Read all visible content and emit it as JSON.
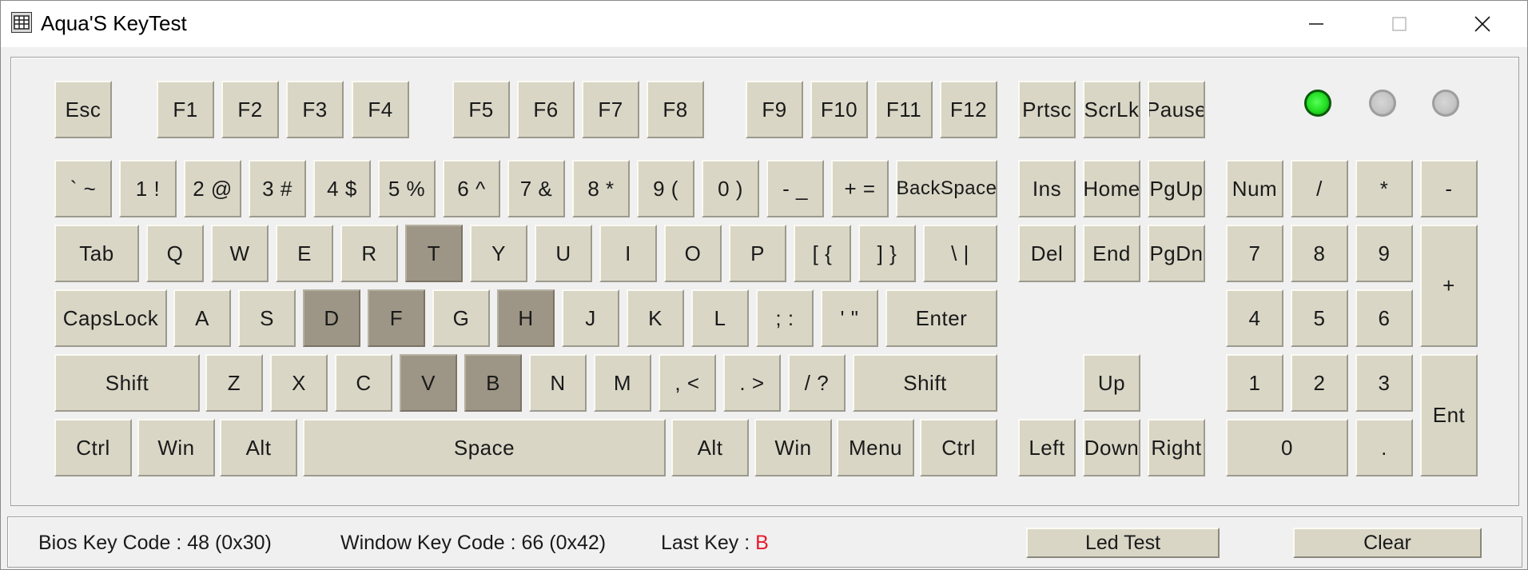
{
  "window": {
    "title": "Aqua'S KeyTest",
    "icon": "keyboard-grid-icon"
  },
  "controls": {
    "minimize": "minimize-icon",
    "maximize": "maximize-icon",
    "close": "close-icon"
  },
  "keys": [
    {
      "id": "esc",
      "label": "Esc",
      "pressed": false
    },
    {
      "id": "f1",
      "label": "F1",
      "pressed": false
    },
    {
      "id": "f2",
      "label": "F2",
      "pressed": false
    },
    {
      "id": "f3",
      "label": "F3",
      "pressed": false
    },
    {
      "id": "f4",
      "label": "F4",
      "pressed": false
    },
    {
      "id": "f5",
      "label": "F5",
      "pressed": false
    },
    {
      "id": "f6",
      "label": "F6",
      "pressed": false
    },
    {
      "id": "f7",
      "label": "F7",
      "pressed": false
    },
    {
      "id": "f8",
      "label": "F8",
      "pressed": false
    },
    {
      "id": "f9",
      "label": "F9",
      "pressed": false
    },
    {
      "id": "f10",
      "label": "F10",
      "pressed": false
    },
    {
      "id": "f11",
      "label": "F11",
      "pressed": false
    },
    {
      "id": "f12",
      "label": "F12",
      "pressed": false
    },
    {
      "id": "prtsc",
      "label": "Prtsc",
      "pressed": false
    },
    {
      "id": "scrlk",
      "label": "ScrLk",
      "pressed": false
    },
    {
      "id": "pause",
      "label": "Pause",
      "pressed": false
    },
    {
      "id": "backtick",
      "label": "` ~",
      "pressed": false
    },
    {
      "id": "1",
      "label": "1 !",
      "pressed": false
    },
    {
      "id": "2",
      "label": "2 @",
      "pressed": false
    },
    {
      "id": "3",
      "label": "3 #",
      "pressed": false
    },
    {
      "id": "4",
      "label": "4 $",
      "pressed": false
    },
    {
      "id": "5",
      "label": "5 %",
      "pressed": false
    },
    {
      "id": "6",
      "label": "6 ^",
      "pressed": false
    },
    {
      "id": "7",
      "label": "7 &",
      "pressed": false
    },
    {
      "id": "8",
      "label": "8 *",
      "pressed": false
    },
    {
      "id": "9",
      "label": "9 (",
      "pressed": false
    },
    {
      "id": "0",
      "label": "0 )",
      "pressed": false
    },
    {
      "id": "minus",
      "label": "- _",
      "pressed": false
    },
    {
      "id": "equals",
      "label": "+ =",
      "pressed": false
    },
    {
      "id": "backspace",
      "label": "BackSpace",
      "pressed": false
    },
    {
      "id": "ins",
      "label": "Ins",
      "pressed": false
    },
    {
      "id": "home",
      "label": "Home",
      "pressed": false
    },
    {
      "id": "pgup",
      "label": "PgUp",
      "pressed": false
    },
    {
      "id": "numlock",
      "label": "Num",
      "pressed": false
    },
    {
      "id": "numslash",
      "label": "/",
      "pressed": false
    },
    {
      "id": "numstar",
      "label": "*",
      "pressed": false
    },
    {
      "id": "numminus",
      "label": "-",
      "pressed": false
    },
    {
      "id": "tab",
      "label": "Tab",
      "pressed": false
    },
    {
      "id": "q",
      "label": "Q",
      "pressed": false
    },
    {
      "id": "w",
      "label": "W",
      "pressed": false
    },
    {
      "id": "e",
      "label": "E",
      "pressed": false
    },
    {
      "id": "r",
      "label": "R",
      "pressed": false
    },
    {
      "id": "t",
      "label": "T",
      "pressed": true
    },
    {
      "id": "y",
      "label": "Y",
      "pressed": false
    },
    {
      "id": "u",
      "label": "U",
      "pressed": false
    },
    {
      "id": "i",
      "label": "I",
      "pressed": false
    },
    {
      "id": "o",
      "label": "O",
      "pressed": false
    },
    {
      "id": "p",
      "label": "P",
      "pressed": false
    },
    {
      "id": "lbracket",
      "label": "[ {",
      "pressed": false
    },
    {
      "id": "rbracket",
      "label": "] }",
      "pressed": false
    },
    {
      "id": "backslash",
      "label": "\\ |",
      "pressed": false
    },
    {
      "id": "del",
      "label": "Del",
      "pressed": false
    },
    {
      "id": "end",
      "label": "End",
      "pressed": false
    },
    {
      "id": "pgdn",
      "label": "PgDn",
      "pressed": false
    },
    {
      "id": "num7",
      "label": "7",
      "pressed": false
    },
    {
      "id": "num8",
      "label": "8",
      "pressed": false
    },
    {
      "id": "num9",
      "label": "9",
      "pressed": false
    },
    {
      "id": "numplus",
      "label": "+",
      "pressed": false
    },
    {
      "id": "capslock",
      "label": "CapsLock",
      "pressed": false
    },
    {
      "id": "a",
      "label": "A",
      "pressed": false
    },
    {
      "id": "s",
      "label": "S",
      "pressed": false
    },
    {
      "id": "d",
      "label": "D",
      "pressed": true
    },
    {
      "id": "f",
      "label": "F",
      "pressed": true
    },
    {
      "id": "g",
      "label": "G",
      "pressed": false
    },
    {
      "id": "h",
      "label": "H",
      "pressed": true
    },
    {
      "id": "j",
      "label": "J",
      "pressed": false
    },
    {
      "id": "k",
      "label": "K",
      "pressed": false
    },
    {
      "id": "l",
      "label": "L",
      "pressed": false
    },
    {
      "id": "semicolon",
      "label": "; :",
      "pressed": false
    },
    {
      "id": "quote",
      "label": "' \"",
      "pressed": false
    },
    {
      "id": "enter",
      "label": "Enter",
      "pressed": false
    },
    {
      "id": "num4",
      "label": "4",
      "pressed": false
    },
    {
      "id": "num5",
      "label": "5",
      "pressed": false
    },
    {
      "id": "num6",
      "label": "6",
      "pressed": false
    },
    {
      "id": "lshift",
      "label": "Shift",
      "pressed": false
    },
    {
      "id": "z",
      "label": "Z",
      "pressed": false
    },
    {
      "id": "x",
      "label": "X",
      "pressed": false
    },
    {
      "id": "c",
      "label": "C",
      "pressed": false
    },
    {
      "id": "v",
      "label": "V",
      "pressed": true
    },
    {
      "id": "b",
      "label": "B",
      "pressed": true
    },
    {
      "id": "n",
      "label": "N",
      "pressed": false
    },
    {
      "id": "m",
      "label": "M",
      "pressed": false
    },
    {
      "id": "comma",
      "label": ", <",
      "pressed": false
    },
    {
      "id": "period",
      "label": ". >",
      "pressed": false
    },
    {
      "id": "slash",
      "label": "/ ?",
      "pressed": false
    },
    {
      "id": "rshift",
      "label": "Shift",
      "pressed": false
    },
    {
      "id": "up",
      "label": "Up",
      "pressed": false
    },
    {
      "id": "num1",
      "label": "1",
      "pressed": false
    },
    {
      "id": "num2",
      "label": "2",
      "pressed": false
    },
    {
      "id": "num3",
      "label": "3",
      "pressed": false
    },
    {
      "id": "numenter",
      "label": "Ent",
      "pressed": false
    },
    {
      "id": "lctrl",
      "label": "Ctrl",
      "pressed": false
    },
    {
      "id": "lwin",
      "label": "Win",
      "pressed": false
    },
    {
      "id": "lalt",
      "label": "Alt",
      "pressed": false
    },
    {
      "id": "space",
      "label": "Space",
      "pressed": false
    },
    {
      "id": "ralt",
      "label": "Alt",
      "pressed": false
    },
    {
      "id": "rwin",
      "label": "Win",
      "pressed": false
    },
    {
      "id": "menu",
      "label": "Menu",
      "pressed": false
    },
    {
      "id": "rctrl",
      "label": "Ctrl",
      "pressed": false
    },
    {
      "id": "left",
      "label": "Left",
      "pressed": false
    },
    {
      "id": "down",
      "label": "Down",
      "pressed": false
    },
    {
      "id": "right",
      "label": "Right",
      "pressed": false
    },
    {
      "id": "num0",
      "label": "0",
      "pressed": false
    },
    {
      "id": "numdot",
      "label": ".",
      "pressed": false
    }
  ],
  "leds": [
    {
      "name": "led-1",
      "on": true
    },
    {
      "name": "led-2",
      "on": false
    },
    {
      "name": "led-3",
      "on": false
    }
  ],
  "status": {
    "bios_label": "Bios Key Code : 48 (0x30)",
    "window_label": "Window Key Code : 66 (0x42)",
    "last_key_label": "Last Key :",
    "last_key_value": "B",
    "led_test_label": "Led Test",
    "clear_label": "Clear"
  }
}
